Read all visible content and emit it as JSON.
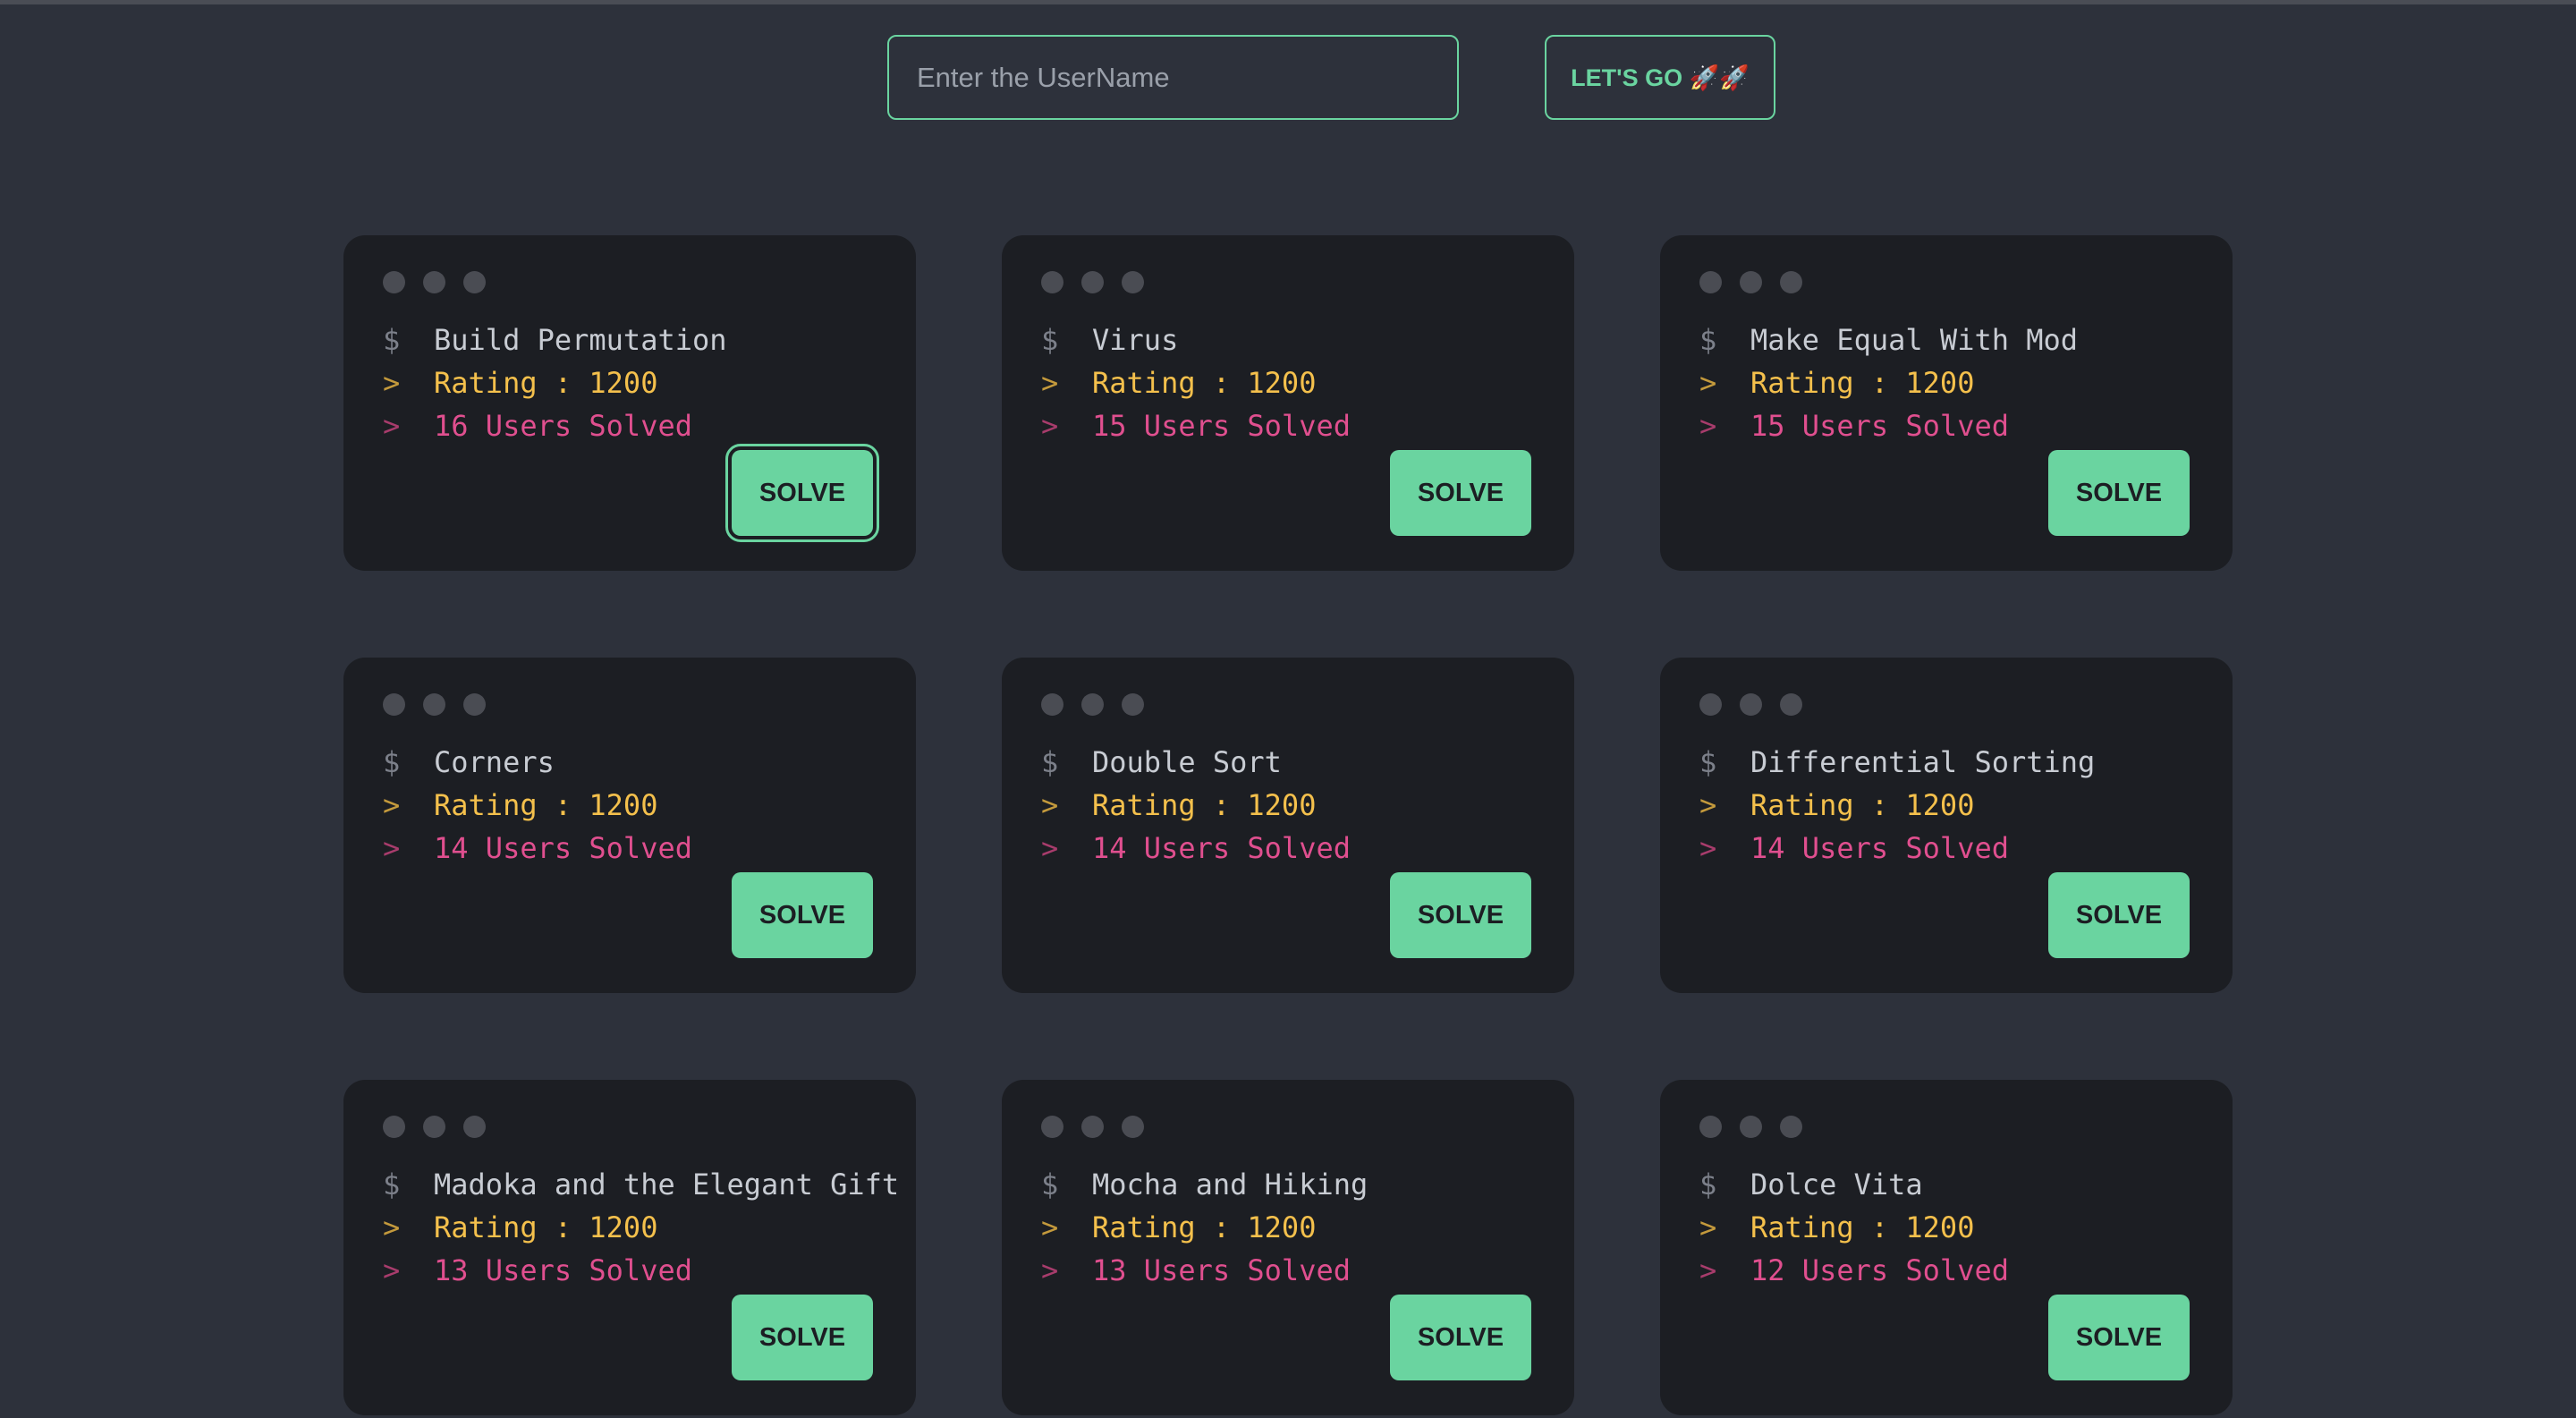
{
  "search": {
    "placeholder": "Enter the UserName",
    "value": ""
  },
  "go_button": {
    "label": "LET'S GO 🚀🚀"
  },
  "problems": [
    {
      "title": "Build Permutation",
      "rating": "Rating : 1200",
      "solved": "16 Users Solved",
      "button": "SOLVE",
      "focused": true
    },
    {
      "title": "Virus",
      "rating": "Rating : 1200",
      "solved": "15 Users Solved",
      "button": "SOLVE"
    },
    {
      "title": "Make Equal With Mod",
      "rating": "Rating : 1200",
      "solved": "15 Users Solved",
      "button": "SOLVE"
    },
    {
      "title": "Corners",
      "rating": "Rating : 1200",
      "solved": "14 Users Solved",
      "button": "SOLVE"
    },
    {
      "title": "Double Sort",
      "rating": "Rating : 1200",
      "solved": "14 Users Solved",
      "button": "SOLVE"
    },
    {
      "title": "Differential Sorting",
      "rating": "Rating : 1200",
      "solved": "14 Users Solved",
      "button": "SOLVE"
    },
    {
      "title": "Madoka and the Elegant Gift",
      "rating": "Rating : 1200",
      "solved": "13 Users Solved",
      "button": "SOLVE"
    },
    {
      "title": "Mocha and Hiking",
      "rating": "Rating : 1200",
      "solved": "13 Users Solved",
      "button": "SOLVE"
    },
    {
      "title": "Dolce Vita",
      "rating": "Rating : 1200",
      "solved": "12 Users Solved",
      "button": "SOLVE"
    }
  ],
  "prompts": {
    "command": "$",
    "output": ">"
  },
  "colors": {
    "background": "#2d313b",
    "card": "#1c1e23",
    "accent": "#6ad4a0",
    "rating": "#f4c04c",
    "solved": "#e04f8f",
    "title": "#c8ccd3"
  }
}
